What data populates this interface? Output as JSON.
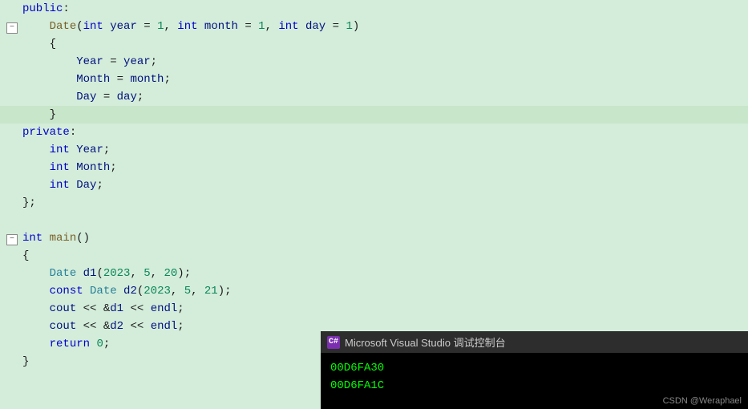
{
  "editor": {
    "background": "#d4edda",
    "lines": [
      {
        "indent": 0,
        "fold": false,
        "content": "public:"
      },
      {
        "indent": 1,
        "fold": true,
        "foldOpen": true,
        "content": "Date(int year = 1, int month = 1, int day = 1)"
      },
      {
        "indent": 1,
        "fold": false,
        "content": "{"
      },
      {
        "indent": 2,
        "fold": false,
        "content": "Year = year;"
      },
      {
        "indent": 2,
        "fold": false,
        "content": "Month = month;"
      },
      {
        "indent": 2,
        "fold": false,
        "content": "Day = day;"
      },
      {
        "indent": 1,
        "fold": false,
        "content": "}"
      },
      {
        "indent": 0,
        "fold": false,
        "content": "private:"
      },
      {
        "indent": 1,
        "fold": false,
        "content": "int Year;"
      },
      {
        "indent": 1,
        "fold": false,
        "content": "int Month;"
      },
      {
        "indent": 1,
        "fold": false,
        "content": "int Day;"
      },
      {
        "indent": 0,
        "fold": false,
        "content": "};"
      },
      {
        "indent": 0,
        "fold": false,
        "content": ""
      },
      {
        "indent": 0,
        "fold": true,
        "foldOpen": true,
        "content": "int main()"
      },
      {
        "indent": 0,
        "fold": false,
        "content": "{"
      },
      {
        "indent": 1,
        "fold": false,
        "content": "Date d1(2023, 5, 20);"
      },
      {
        "indent": 1,
        "fold": false,
        "content": "const Date d2(2023, 5, 21);"
      },
      {
        "indent": 1,
        "fold": false,
        "content": "cout << &d1 << endl;"
      },
      {
        "indent": 1,
        "fold": false,
        "content": "cout << &d2 << endl;"
      },
      {
        "indent": 1,
        "fold": false,
        "content": "return 0;"
      },
      {
        "indent": 0,
        "fold": false,
        "content": "}"
      }
    ]
  },
  "console": {
    "title": "Microsoft Visual Studio 调试控制台",
    "icon_label": "C#",
    "lines": [
      "00D6FA30",
      "00D6FA1C"
    ],
    "watermark": "CSDN @Weraphael"
  }
}
